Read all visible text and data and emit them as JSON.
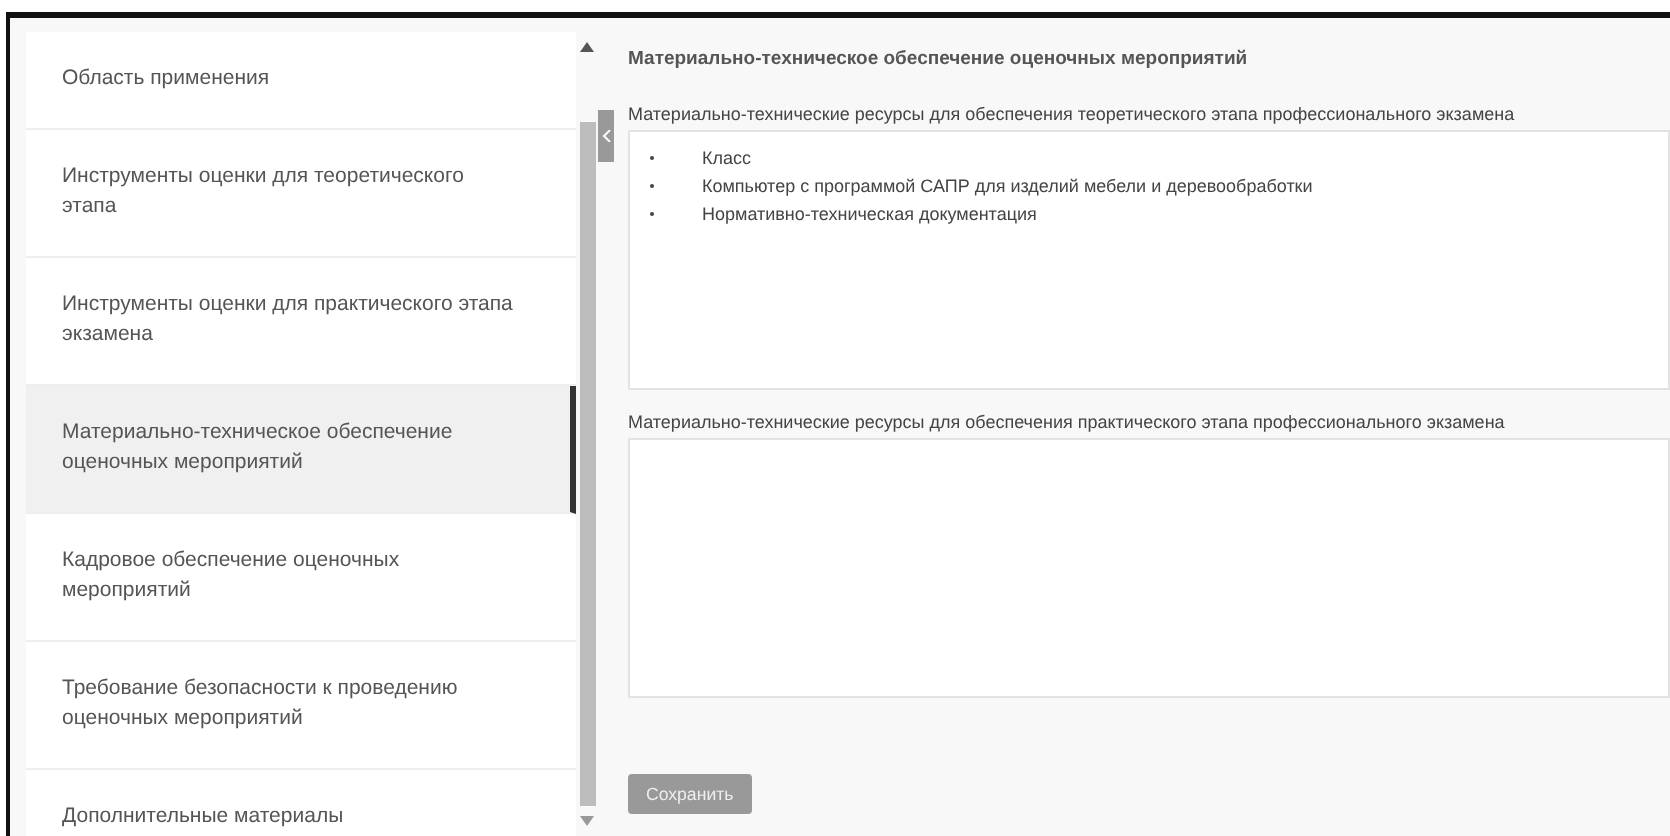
{
  "sidebar": {
    "items": [
      {
        "label": "Область применения",
        "selected": false
      },
      {
        "label": "Инструменты оценки для теоретического этапа",
        "selected": false
      },
      {
        "label": "Инструменты оценки для практического этапа экзамена",
        "selected": false
      },
      {
        "label": "Материально-техническое обеспечение оценочных мероприятий",
        "selected": true
      },
      {
        "label": "Кадровое обеспечение оценочных мероприятий",
        "selected": false
      },
      {
        "label": "Требование безопасности к проведению оценочных мероприятий",
        "selected": false
      },
      {
        "label": "Дополнительные материалы",
        "selected": false
      }
    ]
  },
  "content": {
    "title": "Материально-техническое обеспечение оценочных мероприятий",
    "fields": [
      {
        "label": "Материально-технические ресурсы для обеспечения теоретического этапа профессионального экзамена",
        "items": [
          "Класс",
          "Компьютер с программой САПР для изделий мебели и деревообработки",
          "Нормативно-техническая документация"
        ]
      },
      {
        "label": "Материально-технические ресурсы для обеспечения практического этапа профессионального экзамена"
      }
    ],
    "save_button": "Сохранить"
  }
}
